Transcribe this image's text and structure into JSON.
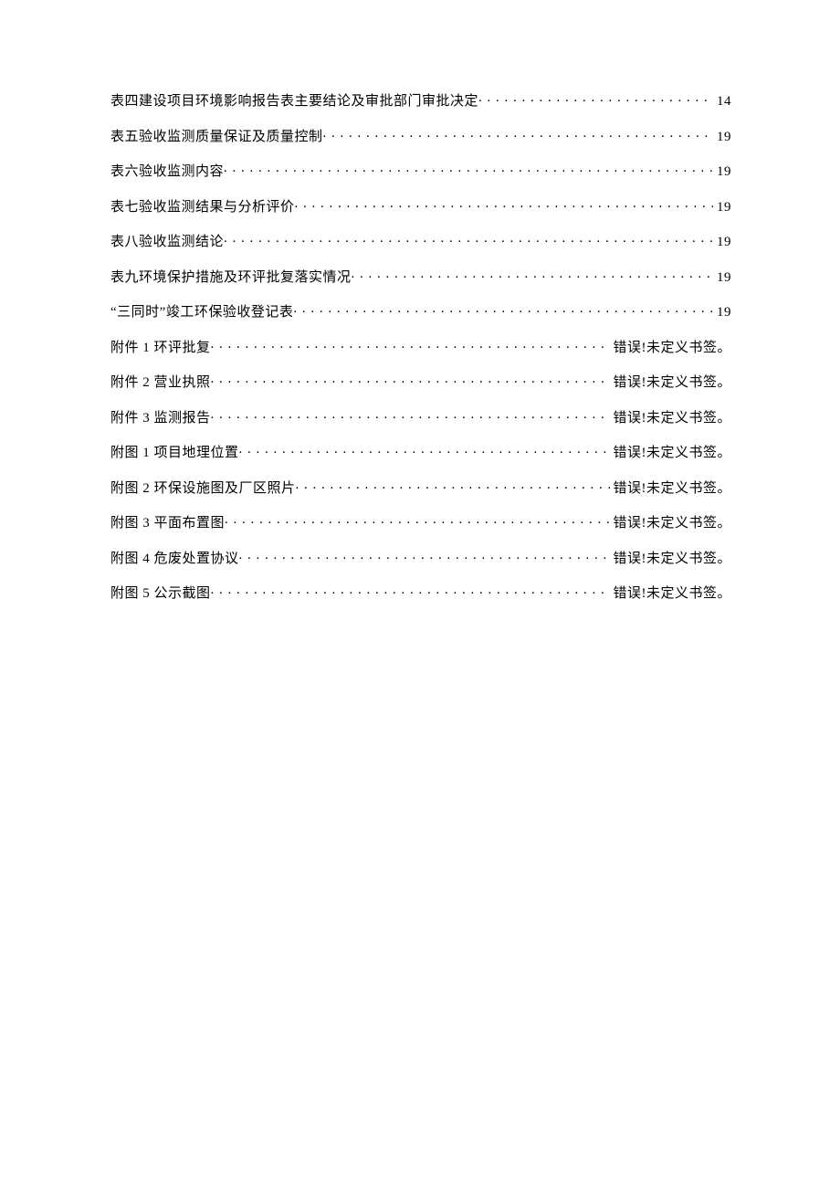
{
  "toc": [
    {
      "title": "表四建设项目环境影响报告表主要结论及审批部门审批决定",
      "page": "14"
    },
    {
      "title": "表五验收监测质量保证及质量控制",
      "page": "19"
    },
    {
      "title": "表六验收监测内容",
      "page": "19"
    },
    {
      "title": "表七验收监测结果与分析评价",
      "page": "19"
    },
    {
      "title": "表八验收监测结论",
      "page": "19"
    },
    {
      "title": "表九环境保护措施及环评批复落实情况",
      "page": "19"
    },
    {
      "title": "“三同时”竣工环保验收登记表",
      "page": "19"
    },
    {
      "title": "附件 1 环评批复",
      "page": "错误!未定义书签。"
    },
    {
      "title": "附件 2 营业执照",
      "page": "错误!未定义书签。"
    },
    {
      "title": "附件 3 监测报告",
      "page": "错误!未定义书签。"
    },
    {
      "title": "附图 1 项目地理位置",
      "page": "错误!未定义书签。"
    },
    {
      "title": "附图 2 环保设施图及厂区照片",
      "page": "错误!未定义书签。"
    },
    {
      "title": "附图 3 平面布置图",
      "page": "错误!未定义书签。"
    },
    {
      "title": "附图 4 危废处置协议",
      "page": "错误!未定义书签。"
    },
    {
      "title": "附图 5 公示截图",
      "page": "错误!未定义书签。"
    }
  ]
}
